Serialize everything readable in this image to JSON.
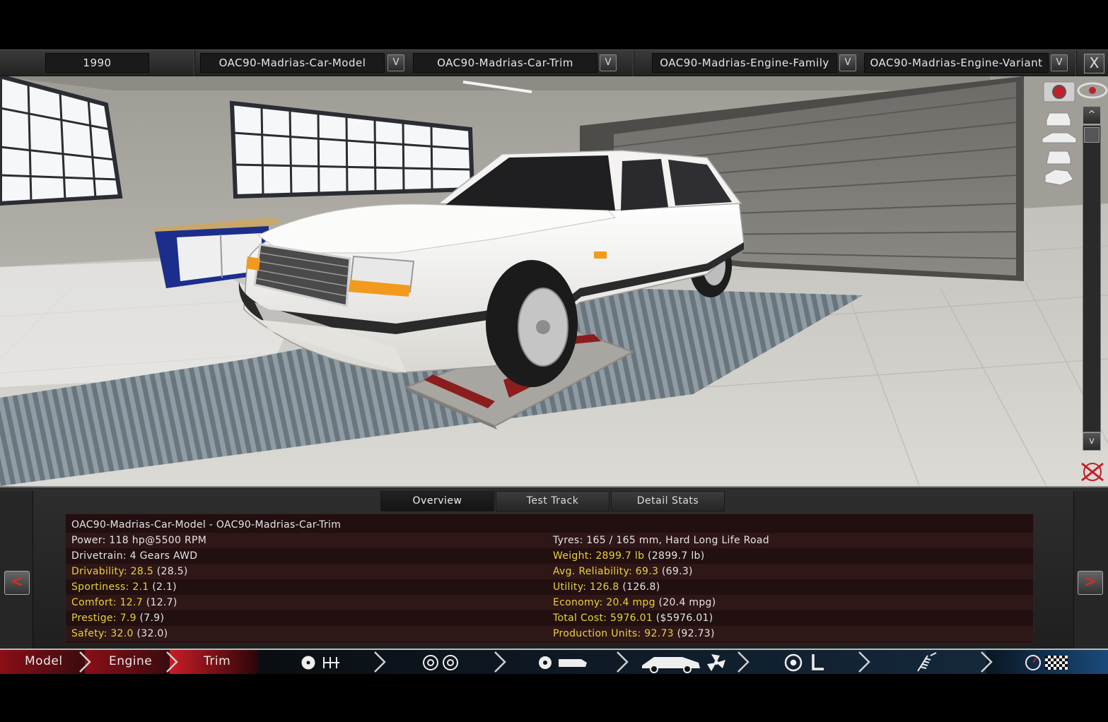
{
  "topbar": {
    "year": "1990",
    "car_model": "OAC90-Madrias-Car-Model",
    "car_trim": "OAC90-Madrias-Car-Trim",
    "engine_family": "OAC90-Madrias-Engine-Family",
    "engine_variant": "OAC90-Madrias-Engine-Variant",
    "dropdown_glyph": "V",
    "close_glyph": "X"
  },
  "viewport": {
    "scroll_up_glyph": "^",
    "scroll_down_glyph": "v",
    "icons": [
      "camera-icon",
      "eye-icon",
      "view-front-icon",
      "view-side-icon",
      "view-rear-icon",
      "view-angled-icon",
      "reset-view-icon"
    ]
  },
  "panel": {
    "tabs": [
      "Overview",
      "Test Track",
      "Detail Stats"
    ],
    "active_tab": "Overview",
    "prev_glyph": "<",
    "next_glyph": ">",
    "title": "OAC90-Madrias-Car-Model - OAC90-Madrias-Car-Trim",
    "left": [
      {
        "label": "Power: 118 hp@5500 RPM"
      },
      {
        "label": "Drivetrain: 4 Gears AWD"
      },
      {
        "key": "Drivability: ",
        "value": "28.5",
        "paren": " (28.5)"
      },
      {
        "key": "Sportiness: ",
        "value": "2.1",
        "paren": " (2.1)"
      },
      {
        "key": "Comfort: ",
        "value": "12.7",
        "paren": " (12.7)"
      },
      {
        "key": "Prestige: ",
        "value": "7.9",
        "paren": " (7.9)"
      },
      {
        "key": "Safety: ",
        "value": "32.0",
        "paren": " (32.0)"
      }
    ],
    "right": [
      {
        "label": "Tyres: 165 / 165 mm, Hard Long Life Road"
      },
      {
        "key": "Weight: ",
        "value": "2899.7 lb",
        "paren": " (2899.7 lb)"
      },
      {
        "key": "Avg. Reliability: ",
        "value": "69.3",
        "paren": " (69.3)"
      },
      {
        "key": "Utility: ",
        "value": "126.8",
        "paren": " (126.8)"
      },
      {
        "key": "Economy: ",
        "value": "20.4 mpg",
        "paren": " (20.4 mpg)"
      },
      {
        "key": "Total Cost: ",
        "value": "5976.01",
        "paren": " ($5976.01)"
      },
      {
        "key": "Production Units: ",
        "value": "92.73",
        "paren": " (92.73)"
      }
    ]
  },
  "nav": {
    "model": "Model",
    "engine": "Engine",
    "trim": "Trim",
    "icons": [
      "brakes-gearbox-icon",
      "wheels-icon",
      "body-icon",
      "car-fan-icon",
      "steering-seat-icon",
      "suspension-icon",
      "test-drive-icon"
    ]
  },
  "colors": {
    "highlight_yellow": "#e8d23a",
    "trim_active": "#c0202a",
    "stats_bg": "#220f10"
  }
}
